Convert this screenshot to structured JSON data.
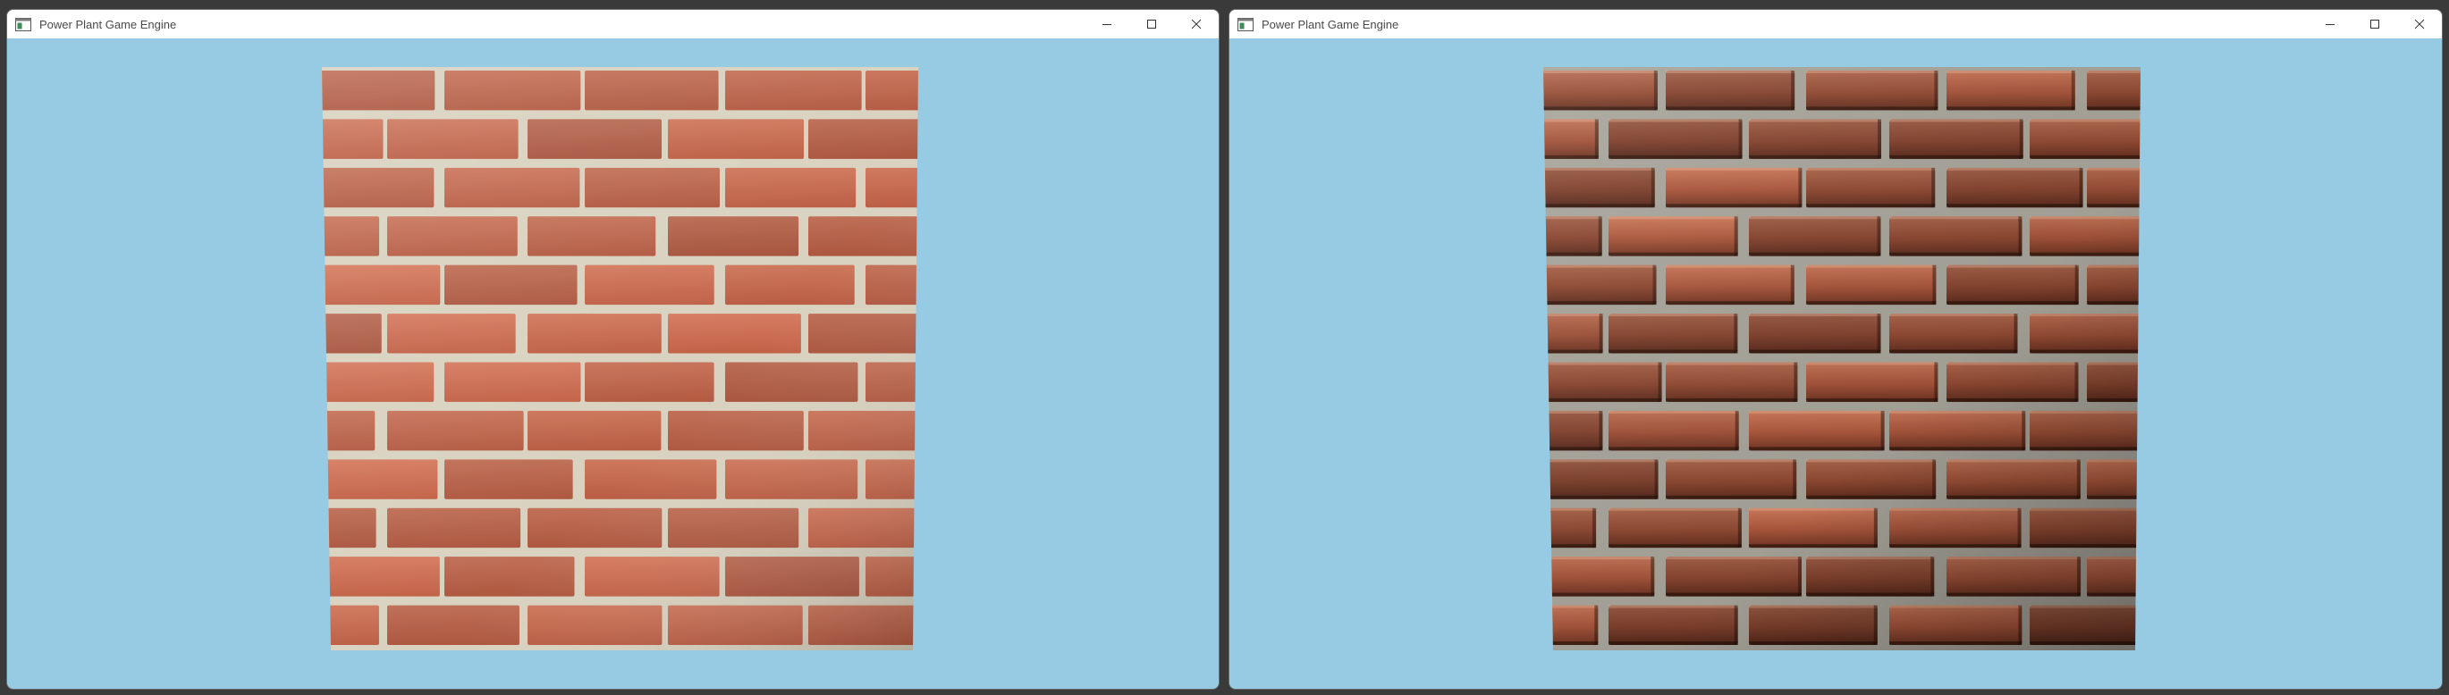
{
  "windows": [
    {
      "title": "Power Plant Game Engine",
      "icon": "app-window-icon",
      "controls": [
        "minimize-icon",
        "maximize-icon",
        "close-icon"
      ],
      "scene": {
        "background": "#97cae3",
        "object": "brick-wall-quad",
        "shading": "flat-diffuse",
        "brick_color": "#c8694e",
        "mortar_color": "#d9d2c0"
      }
    },
    {
      "title": "Power Plant Game Engine",
      "icon": "app-window-icon",
      "controls": [
        "minimize-icon",
        "maximize-icon",
        "close-icon"
      ],
      "scene": {
        "background": "#97cae3",
        "object": "brick-wall-quad",
        "shading": "normal-mapped",
        "brick_color": "#a8593c",
        "mortar_color": "#a9a69c"
      }
    }
  ]
}
